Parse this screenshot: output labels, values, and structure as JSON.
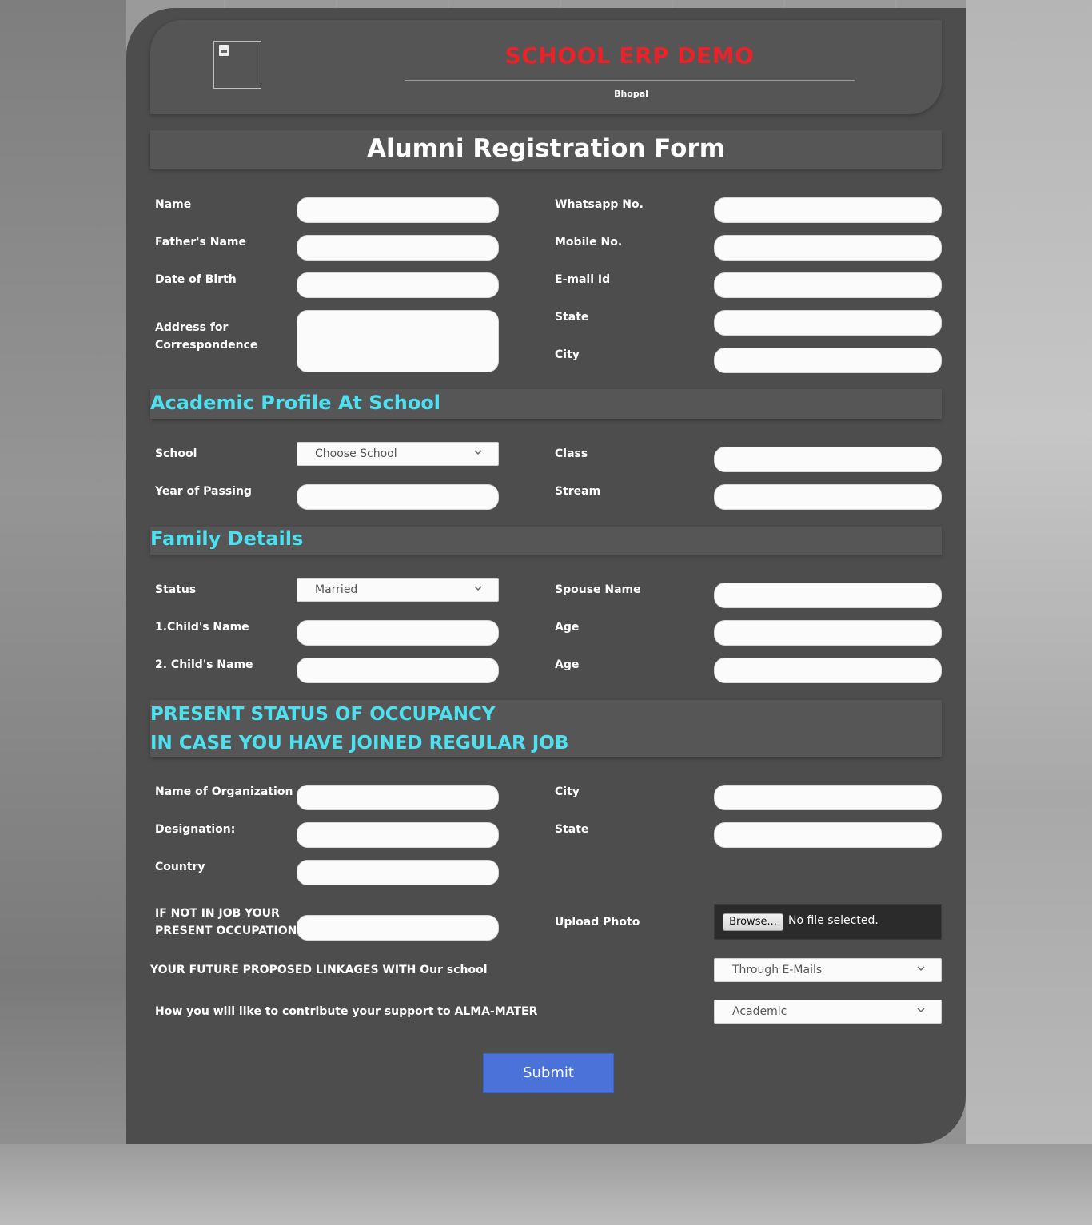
{
  "header": {
    "school_name": "SCHOOL ERP DEMO",
    "city": "Bhopal",
    "logo_icon": "broken-image-icon"
  },
  "form_title": "Alumni Registration Form",
  "personal": {
    "name_label": "Name",
    "father_label": "Father's Name",
    "dob_label": "Date of Birth",
    "address_label": "Address for Correspondence",
    "whatsapp_label": "Whatsapp No.",
    "mobile_label": "Mobile No.",
    "email_label": "E-mail Id",
    "state_label": "State",
    "city_label": "City"
  },
  "academic": {
    "title": "Academic Profile At School",
    "school_label": "School",
    "school_value": "Choose School",
    "year_label": "Year of Passing",
    "class_label": "Class",
    "stream_label": "Stream"
  },
  "family": {
    "title": "Family Details",
    "status_label": "Status",
    "status_value": "Married",
    "child1_label": "1.Child's Name",
    "child2_label": "2. Child's Name",
    "spouse_label": "Spouse Name",
    "age1_label": "Age",
    "age2_label": "Age"
  },
  "occupancy": {
    "title_line1": "PRESENT STATUS OF OCCUPANCY",
    "title_line2": "IN CASE YOU HAVE JOINED REGULAR JOB",
    "org_label": "Name of Organization",
    "designation_label": "Designation:",
    "country_label": "Country",
    "not_in_job_label_line1": "IF NOT IN JOB YOUR",
    "not_in_job_label_line2": "PRESENT OCCUPATION",
    "city_label": "City",
    "state_label": "State",
    "upload_label": "Upload Photo",
    "browse_label": "Browse...",
    "file_status": "No file selected.",
    "linkages_label": "YOUR FUTURE PROPOSED LINKAGES WITH Our school",
    "linkages_value": "Through E-Mails",
    "contribute_label": "How you will like to contribute your support to ALMA-MATER",
    "contribute_value": "Academic"
  },
  "submit_label": "Submit",
  "colors": {
    "accent_title": "#e8232a",
    "section_title": "#4fe0f0",
    "submit": "#4a72d8",
    "panel": "#4d4d4d"
  }
}
